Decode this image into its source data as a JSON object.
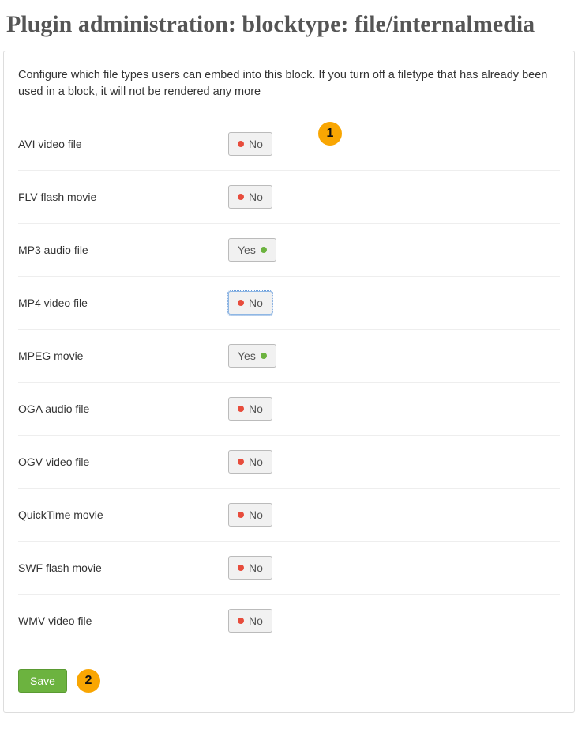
{
  "page_title": "Plugin administration: blocktype: file/internalmedia",
  "description": "Configure which file types users can embed into this block. If you turn off a filetype that has already been used in a block, it will not be rendered any more",
  "toggle_labels": {
    "yes": "Yes",
    "no": "No"
  },
  "options": [
    {
      "label": "AVI video file",
      "value": "no",
      "focused": false,
      "callout": "1"
    },
    {
      "label": "FLV flash movie",
      "value": "no",
      "focused": false
    },
    {
      "label": "MP3 audio file",
      "value": "yes",
      "focused": false
    },
    {
      "label": "MP4 video file",
      "value": "no",
      "focused": true
    },
    {
      "label": "MPEG movie",
      "value": "yes",
      "focused": false
    },
    {
      "label": "OGA audio file",
      "value": "no",
      "focused": false
    },
    {
      "label": "OGV video file",
      "value": "no",
      "focused": false
    },
    {
      "label": "QuickTime movie",
      "value": "no",
      "focused": false
    },
    {
      "label": "SWF flash movie",
      "value": "no",
      "focused": false
    },
    {
      "label": "WMV video file",
      "value": "no",
      "focused": false
    }
  ],
  "save_label": "Save",
  "save_callout": "2",
  "colors": {
    "accent_green": "#6cb33f",
    "accent_red": "#e74c3c",
    "callout": "#f9a602"
  }
}
